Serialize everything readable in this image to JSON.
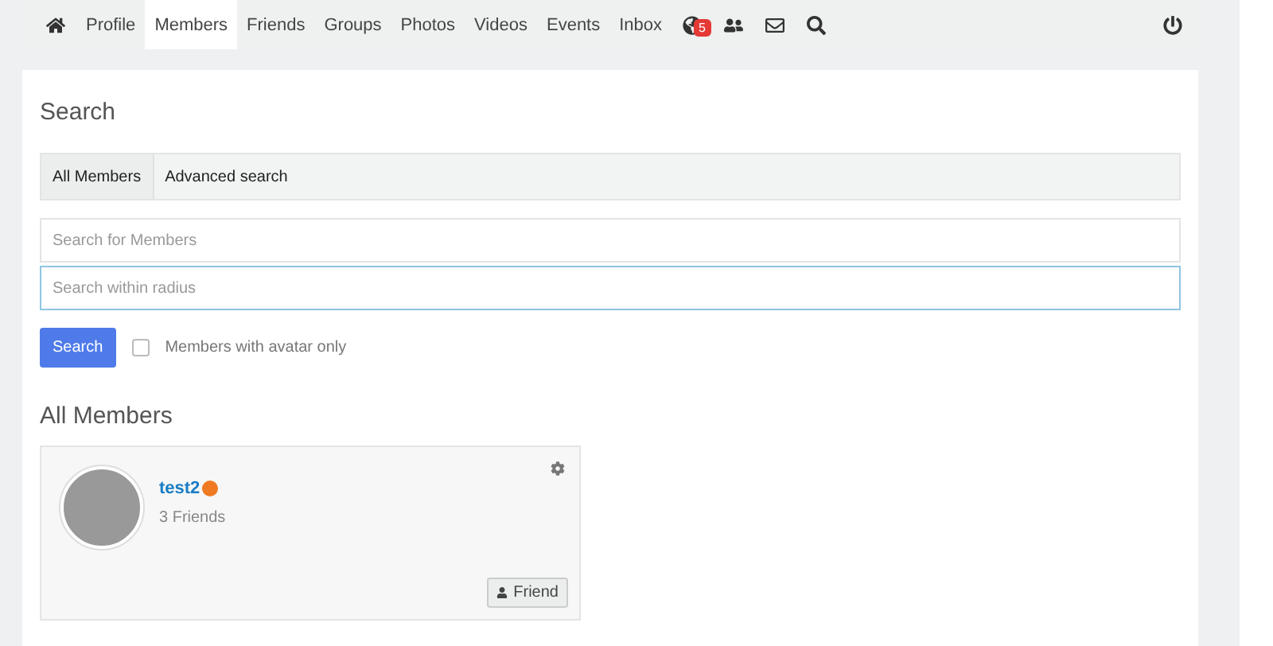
{
  "nav": {
    "items": [
      {
        "label": "Profile",
        "selected": false
      },
      {
        "label": "Members",
        "selected": true
      },
      {
        "label": "Friends",
        "selected": false
      },
      {
        "label": "Groups",
        "selected": false
      },
      {
        "label": "Photos",
        "selected": false
      },
      {
        "label": "Videos",
        "selected": false
      },
      {
        "label": "Events",
        "selected": false
      },
      {
        "label": "Inbox",
        "selected": false
      }
    ],
    "notification_count": "5"
  },
  "search": {
    "title": "Search",
    "tabs": [
      {
        "label": "All Members",
        "selected": true
      },
      {
        "label": "Advanced search",
        "selected": false
      }
    ],
    "member_field": {
      "placeholder": "Search for Members"
    },
    "radius_field": {
      "placeholder": "Search within radius"
    },
    "button": "Search",
    "avatar_only": {
      "label": "Members with avatar only",
      "checked": false
    }
  },
  "members": {
    "title": "All Members",
    "cards": [
      {
        "name": "test2",
        "friends": "3 Friends",
        "action": "Friend"
      }
    ]
  }
}
